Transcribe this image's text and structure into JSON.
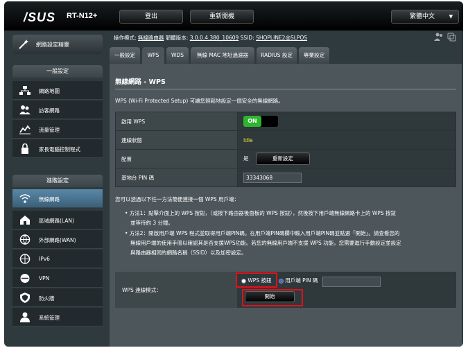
{
  "header": {
    "logo": "/SUS",
    "model": "RT-N12+",
    "logout_label": "登出",
    "reboot_label": "重新開機",
    "language": "繁體中文"
  },
  "info": {
    "mode_label": "操作模式:",
    "mode_value": "無線路由器",
    "firmware_label": "韌體版本:",
    "firmware_value": "3.0.0.4.380_10609",
    "ssid_label": "SSID:",
    "ssid_value": "SHOPLINE2@SLPOS"
  },
  "sidebar": {
    "wizard_label": "網路設定精靈",
    "general_title": "一般設定",
    "general_items": [
      {
        "label": "網路地圖",
        "icon": "network-map-icon"
      },
      {
        "label": "訪客網路",
        "icon": "guest-network-icon"
      },
      {
        "label": "流量管理",
        "icon": "traffic-manager-icon"
      },
      {
        "label": "家長電腦控制程式",
        "icon": "parental-control-icon"
      }
    ],
    "advanced_title": "進階設定",
    "advanced_items": [
      {
        "label": "無線網路",
        "icon": "wireless-icon"
      },
      {
        "label": "區域網路(LAN)",
        "icon": "lan-icon"
      },
      {
        "label": "外部網路(WAN)",
        "icon": "wan-icon"
      },
      {
        "label": "IPv6",
        "icon": "ipv6-icon"
      },
      {
        "label": "VPN",
        "icon": "vpn-icon"
      },
      {
        "label": "防火牆",
        "icon": "firewall-icon"
      },
      {
        "label": "系統管理",
        "icon": "administration-icon"
      }
    ]
  },
  "tabs": [
    {
      "label": "一般設定"
    },
    {
      "label": "WPS"
    },
    {
      "label": "WDS"
    },
    {
      "label": "無線 MAC 地址過濾器"
    },
    {
      "label": "RADIUS 設定"
    },
    {
      "label": "專業設定"
    }
  ],
  "panel": {
    "title": "無線網路 - WPS",
    "description": "WPS (Wi-Fi Protected Setup) 可讓您輕鬆地設定一個安全的無線網路。",
    "rows": {
      "enable_label": "啟用 WPS",
      "enable_value": "ON",
      "status_label": "連線狀態",
      "status_value": "Idle",
      "config_label": "配置",
      "config_value": "是",
      "reset_label": "重新設定",
      "pin_label": "基地台 PIN 碼",
      "pin_value": "33343068"
    },
    "note": "您可以透過以下任一方法簡便連接一個 WPS 用戶端：",
    "method1_line1": "• 方法1：點擊介面上的 WPS 按鈕，（或按下路由器後面板的 WPS 按鈕），然後按下用戶端無線網路卡上的 WPS 按鈕",
    "method1_line2": "並等待約 3 分鐘。",
    "method2_line1": "• 方法2：開啟用戶端 WPS 程式並取得用戶端PIN碼。在用戶端PIN碼欄中輸入用戶端PIN碼並點選「開始」。請查看您的",
    "method2_line2": "無線用戶端的使用手冊以確認其是否支援WPS功能。若您的無線用戶端不支援 WPS 功能，您需要進行手動設定並設定",
    "method2_line3": "與路由器相同的網路名稱（SSID）以及加密設定。",
    "mode_label": "WPS 連線模式：",
    "opt_button": "WPS 按鈕",
    "opt_pin": "用戶端 PIN 碼",
    "start_label": "開始"
  },
  "colors": {
    "background": "#2f3a3e",
    "accent_on": "#2db52d",
    "highlight": "#e0121c"
  }
}
